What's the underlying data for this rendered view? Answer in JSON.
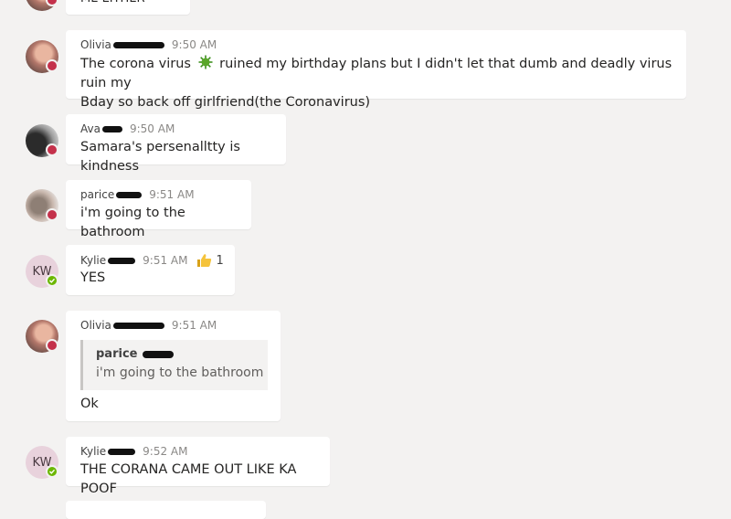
{
  "messages": [
    {
      "text": "ME EITHER"
    },
    {
      "author": "Olivia",
      "time": "9:50 AM",
      "text_before": "The corona virus",
      "text_after": "ruined my birthday plans but I didn't let that dumb and deadly virus ruin my",
      "text_line2": "Bday so back off girlfriend(the Coronavirus)",
      "inline_icon": "virus-emoji-icon"
    },
    {
      "author": "Ava",
      "time": "9:50 AM",
      "text": "Samara's persenalltty is kindness"
    },
    {
      "author": "parice",
      "time": "9:51 AM",
      "text": "i'm going to the bathroom"
    },
    {
      "author": "Kylie",
      "time": "9:51 AM",
      "text": "YES",
      "initials": "KW",
      "reaction_icon": "thumbs-up-icon",
      "reaction_count": "1"
    },
    {
      "author": "Olivia",
      "time": "9:51 AM",
      "quote_author": "parice",
      "quote_text": "i'm going to the bathroom",
      "text": "Ok"
    },
    {
      "author": "Kylie",
      "time": "9:52 AM",
      "text": "THE CORANA CAME OUT LIKE KA POOF",
      "initials": "KW"
    }
  ],
  "colors": {
    "background": "#f3f2f1",
    "bubble": "#ffffff",
    "busy": "#c4314b",
    "available": "#6bb700"
  }
}
